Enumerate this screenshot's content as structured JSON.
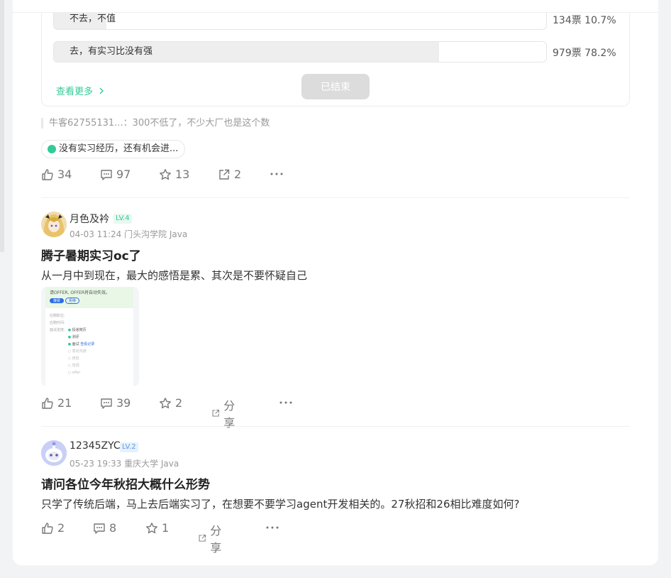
{
  "poll": {
    "options": [
      {
        "label": "不去，不值",
        "result": "134票 10.7%",
        "fraction": 0.107
      },
      {
        "label": "去，有实习比没有强",
        "result": "979票 78.2%",
        "fraction": 0.782
      }
    ],
    "see_more": "查看更多",
    "ended": "已结束"
  },
  "post1": {
    "comment": "牛客62755131...：300不低了，不少大厂也是这个数",
    "topic": "没有实习经历，还有机会进...",
    "likes": "34",
    "comments": "97",
    "stars": "13",
    "shares": "2"
  },
  "post2": {
    "username": "月色及衿",
    "level": "LV.4",
    "meta": "04-03 11:24  门头沟学院 Java",
    "title": "腾子暑期实习oc了",
    "body": "从一月中到现在，最大的感悟是累、其次是不要怀疑自己",
    "thumb": {
      "line1": "请OFFER, OFFER将自动失效。",
      "btn1": "接受",
      "btn2": "拒绝",
      "label1": "应聘职位:",
      "label2": "应聘时间:",
      "label3": "面试进度:",
      "step1": "投递简历",
      "step2": "测评",
      "step3": "面试",
      "step3_note": "查看记录",
      "step4": "意向沟通",
      "step5": "体检",
      "step6": "背调",
      "step7": "offer"
    },
    "likes": "21",
    "comments": "39",
    "stars": "2",
    "share": "分享"
  },
  "post3": {
    "username": "12345ZYC",
    "level": "LV.2",
    "meta": "05-23 19:33  重庆大学 Java",
    "title": "请问各位今年秋招大概什么形势",
    "body": "只学了传统后端，马上去后端实习了，在想要不要学习agent开发相关的。27秋招和26相比难度如何?",
    "likes": "2",
    "comments": "8",
    "stars": "1",
    "share": "分享"
  },
  "colors": {
    "accent": "#32ca99",
    "level4_bg": "#e8f8f1",
    "level2_color": "#5b9be6"
  }
}
